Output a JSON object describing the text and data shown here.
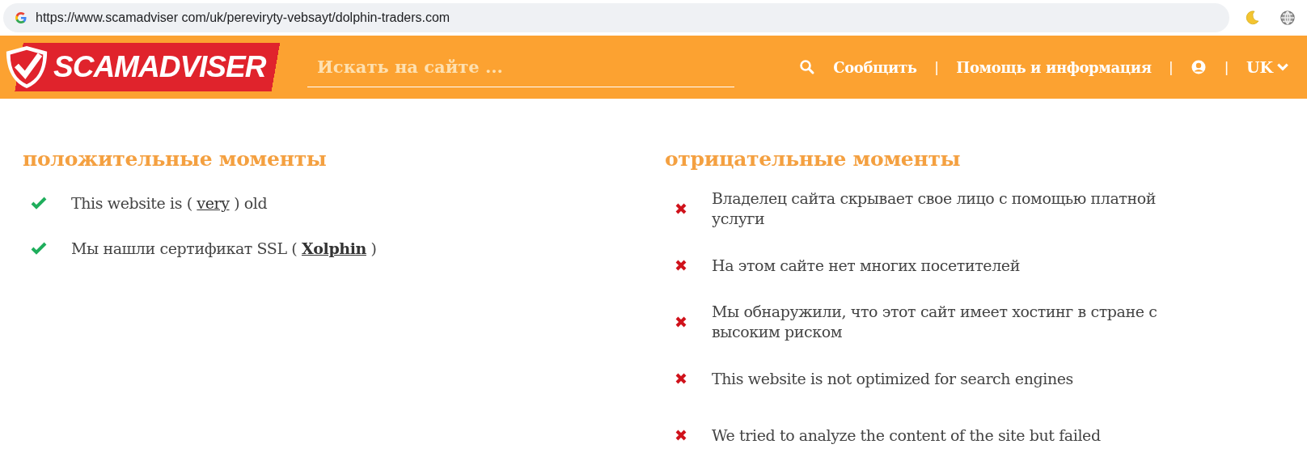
{
  "browser": {
    "url": "https://www.scamadviser com/uk/pereviryty-vebsayt/dolphin-traders.com"
  },
  "header": {
    "logo": "SCAMADVISER",
    "search": {
      "placeholder": "Искать на сайте ..."
    },
    "nav": [
      {
        "kind": "search"
      },
      {
        "kind": "link",
        "label": "Сообщить"
      },
      {
        "kind": "separator",
        "label": "|"
      },
      {
        "kind": "link",
        "label": "Помощь и информация"
      },
      {
        "kind": "separator",
        "label": "|"
      },
      {
        "kind": "account"
      },
      {
        "kind": "separator",
        "label": "|"
      },
      {
        "kind": "language",
        "label": "UK"
      }
    ]
  },
  "positives": {
    "title": "положительные моменты",
    "items": [
      {
        "before": "This website is (",
        "link": "very",
        "after": ") old",
        "link_bold": false
      },
      {
        "before": "Мы нашли сертификат SSL (",
        "link": "Xolphin",
        "after": ")",
        "link_bold": true
      }
    ]
  },
  "negatives": {
    "title": "отрицательные моменты",
    "items": [
      {
        "text": "Владелец сайта скрывает свое лицо с помощью платной услуги"
      },
      {
        "text": "На этом сайте нет многих посетителей"
      },
      {
        "text": "Мы обнаружили, что этот сайт имеет хостинг в стране с высоким риском"
      },
      {
        "text": "This website is not optimized for search engines"
      },
      {
        "text": "We tried to analyze the content of the site but failed"
      }
    ]
  }
}
